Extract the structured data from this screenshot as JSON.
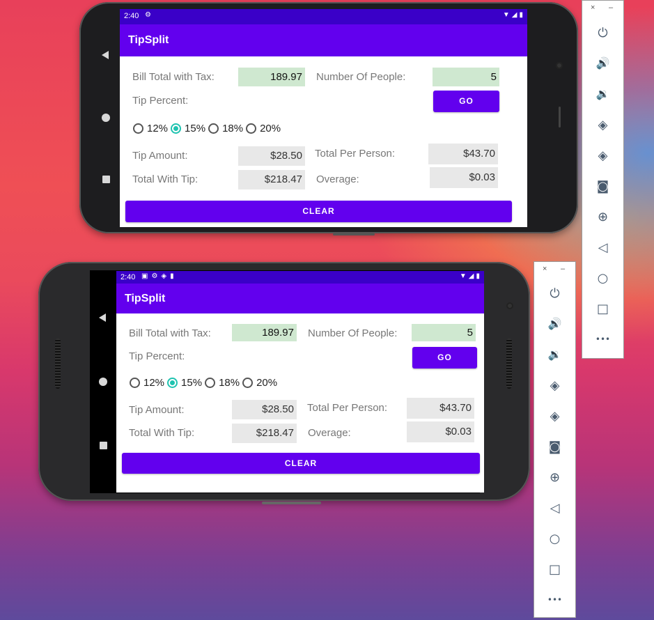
{
  "emulators": [
    {
      "status": {
        "time": "2:40",
        "left_icons": [
          "gear-icon"
        ],
        "right_icons": [
          "wifi-icon",
          "signal-icon",
          "battery-icon"
        ]
      },
      "app_title": "TipSplit",
      "bill_label": "Bill Total with Tax:",
      "bill_value": "189.97",
      "people_label": "Number Of People:",
      "people_value": "5",
      "tip_percent_label": "Tip Percent:",
      "go_label": "GO",
      "tip_options": [
        "12%",
        "15%",
        "18%",
        "20%"
      ],
      "tip_selected": "15%",
      "tip_amount_label": "Tip Amount:",
      "tip_amount_value": "$28.50",
      "total_with_tip_label": "Total With Tip:",
      "total_with_tip_value": "$218.47",
      "per_person_label": "Total Per Person:",
      "per_person_value": "$43.70",
      "overage_label": "Overage:",
      "overage_value": "$0.03",
      "clear_label": "CLEAR"
    },
    {
      "status": {
        "time": "2:40",
        "left_icons": [
          "a-icon",
          "gear-icon",
          "shield-icon",
          "sd-icon"
        ],
        "right_icons": [
          "wifi-icon",
          "signal-icon",
          "battery-icon"
        ]
      },
      "app_title": "TipSplit",
      "bill_label": "Bill Total with Tax:",
      "bill_value": "189.97",
      "people_label": "Number Of People:",
      "people_value": "5",
      "tip_percent_label": "Tip Percent:",
      "go_label": "GO",
      "tip_options": [
        "12%",
        "15%",
        "18%",
        "20%"
      ],
      "tip_selected": "15%",
      "tip_amount_label": "Tip Amount:",
      "tip_amount_value": "$28.50",
      "total_with_tip_label": "Total With Tip:",
      "total_with_tip_value": "$218.47",
      "per_person_label": "Total Per Person:",
      "per_person_value": "$43.70",
      "overage_label": "Overage:",
      "overage_value": "$0.03",
      "clear_label": "CLEAR"
    }
  ],
  "toolbar": {
    "close_glyph": "×",
    "minimize_glyph": "–",
    "buttons": [
      "power-icon",
      "volume-up-icon",
      "volume-down-icon",
      "rotate-left-icon",
      "rotate-right-icon",
      "camera-icon",
      "zoom-icon",
      "back-icon",
      "home-icon",
      "overview-icon",
      "more-icon"
    ],
    "glyphs": {
      "power": "⏻",
      "volume_up": "🔊",
      "volume_down": "🔉",
      "rotate_left": "◈",
      "rotate_right": "◈",
      "camera": "◙",
      "zoom": "⊕",
      "back": "◁",
      "home": "○",
      "overview": "□",
      "more": "•••"
    }
  }
}
